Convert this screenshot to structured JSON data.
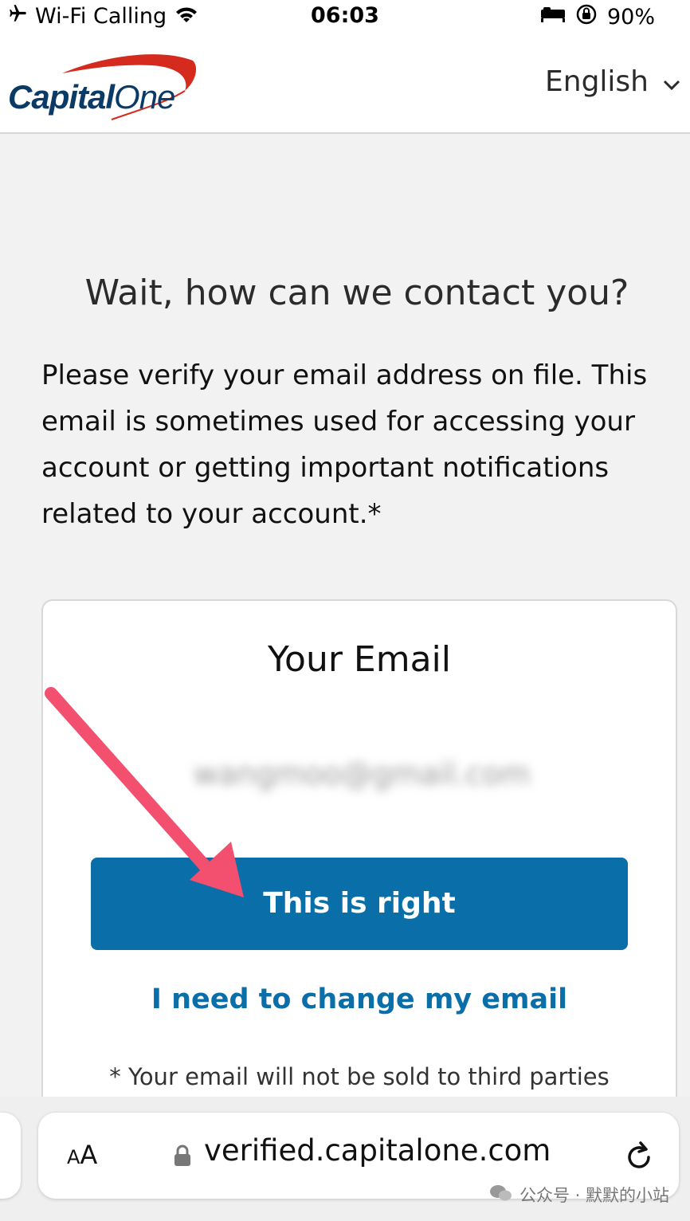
{
  "status_bar": {
    "carrier": "Wi-Fi Calling",
    "time": "06:03",
    "battery": "90%",
    "icons": [
      "airplane-icon",
      "wifi-icon",
      "sleep-icon",
      "orientation-lock-icon"
    ]
  },
  "header": {
    "logo_text_main": "Capital",
    "logo_text_one": "One",
    "language": "English"
  },
  "main": {
    "heading": "Wait, how can we contact you?",
    "intro": "Please verify your email address on file. This email is sometimes used for accessing your account or getting important notifications related to your account.*"
  },
  "card": {
    "title": "Your Email",
    "email_blurred": "wangmoo@gmail.com",
    "confirm_label": "This is right",
    "change_label": "I need to change my email",
    "disclaimer": "* Your email will not be sold to third parties"
  },
  "browser": {
    "aa_small": "A",
    "aa_large": "A",
    "url": "verified.capitalone.com"
  },
  "watermark": "公众号 · 默默的小站",
  "colors": {
    "brand_blue": "#0a6ea8",
    "logo_navy": "#0a3a66",
    "logo_red": "#d52b1e",
    "arrow_pink": "#f2506e"
  }
}
